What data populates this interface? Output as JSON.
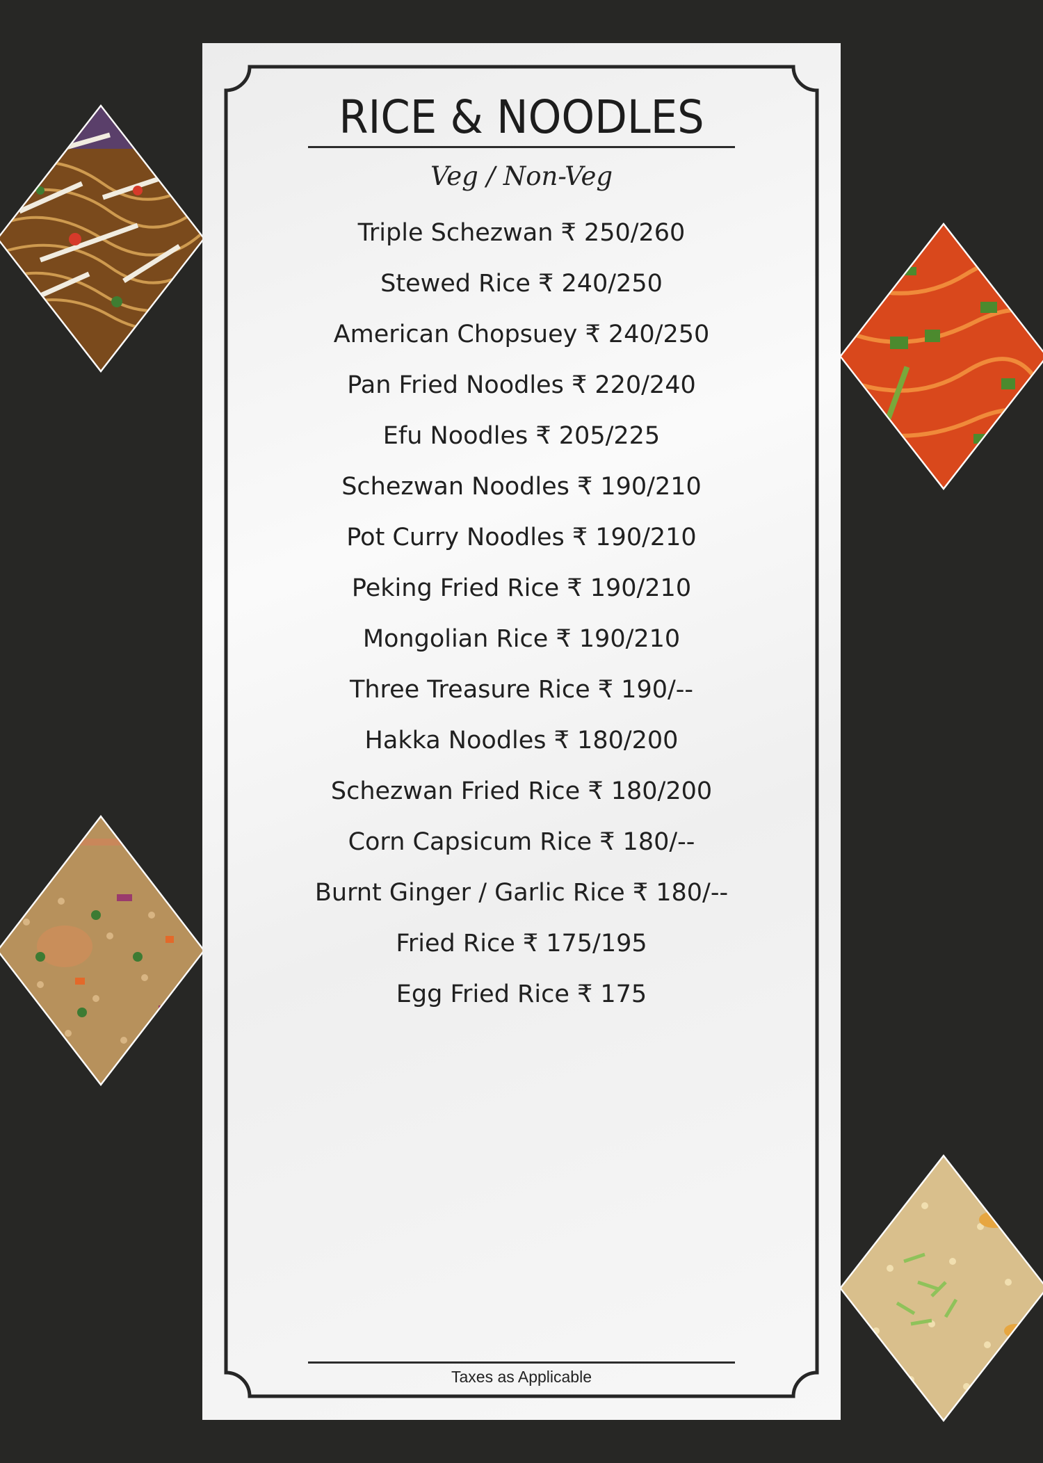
{
  "menu": {
    "title": "RICE & NOODLES",
    "subtitle": "Veg / Non-Veg",
    "items": [
      "Triple Schezwan ₹ 250/260",
      "Stewed Rice ₹ 240/250",
      "American Chopsuey ₹ 240/250",
      "Pan Fried Noodles ₹ 220/240",
      "Efu Noodles ₹ 205/225",
      "Schezwan Noodles ₹ 190/210",
      "Pot Curry Noodles ₹ 190/210",
      "Peking Fried Rice ₹ 190/210",
      "Mongolian Rice ₹ 190/210",
      "Three Treasure Rice ₹ 190/--",
      "Hakka Noodles ₹ 180/200",
      "Schezwan Fried Rice ₹ 180/200",
      "Corn Capsicum Rice ₹ 180/--",
      "Burnt Ginger / Garlic Rice ₹ 180/--",
      "Fried Rice ₹ 175/195",
      "Egg Fried Rice ₹ 175"
    ],
    "footer": "Taxes as Applicable"
  },
  "colors": {
    "background": "#272725",
    "panel": "#f4f4f4",
    "text": "#202020"
  },
  "photos": [
    "hakka-noodles-photo",
    "chilli-garlic-noodles-photo",
    "chicken-fried-rice-photo",
    "egg-fried-rice-photo"
  ]
}
